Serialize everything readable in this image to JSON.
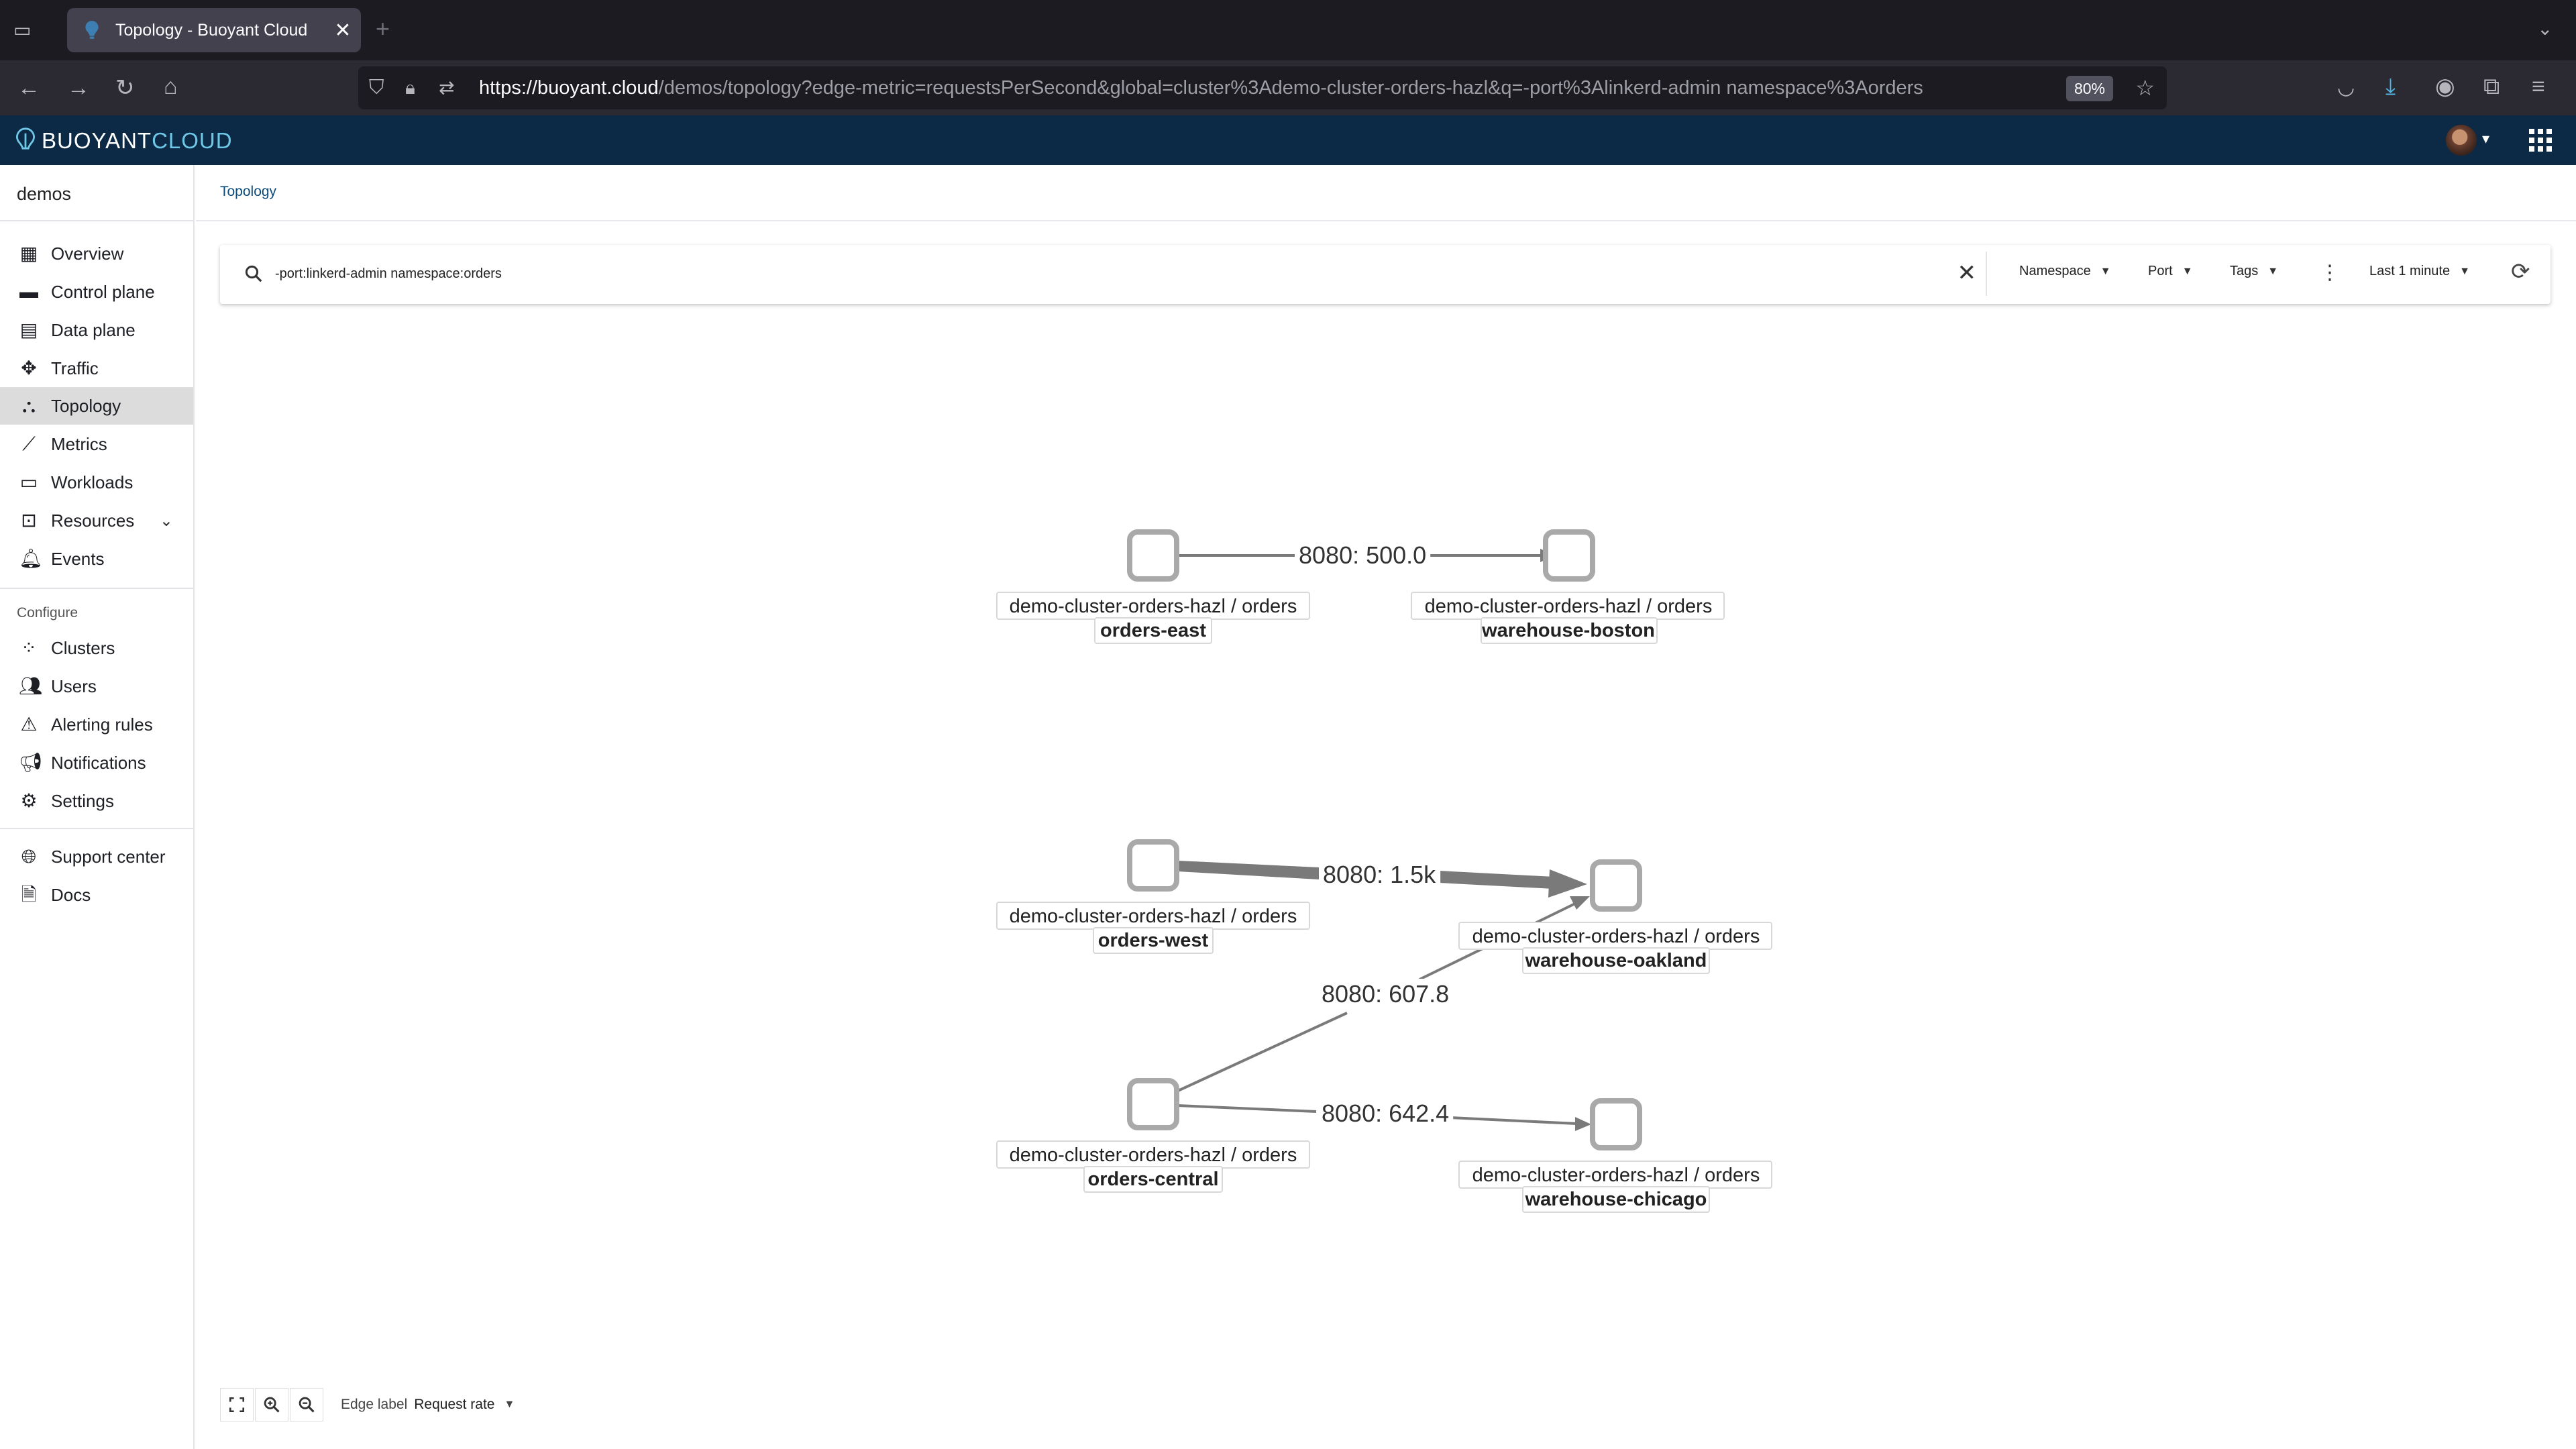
{
  "browser": {
    "tab_title": "Topology - Buoyant Cloud",
    "url_host": "https://buoyant.cloud",
    "url_path": "/demos/topology?edge-metric=requestsPerSecond&global=cluster%3Ademo-cluster-orders-hazl&q=-port%3Alinkerd-admin namespace%3Aorders",
    "zoom": "80%"
  },
  "app": {
    "logo_main": "BUOYANT",
    "logo_accent": "CLOUD"
  },
  "sidebar": {
    "org": "demos",
    "items": [
      {
        "label": "Overview",
        "icon": "dashboard-icon"
      },
      {
        "label": "Control plane",
        "icon": "control-plane-icon"
      },
      {
        "label": "Data plane",
        "icon": "data-plane-icon"
      },
      {
        "label": "Traffic",
        "icon": "traffic-icon"
      },
      {
        "label": "Topology",
        "icon": "topology-icon",
        "active": true
      },
      {
        "label": "Metrics",
        "icon": "metrics-icon"
      },
      {
        "label": "Workloads",
        "icon": "workloads-icon"
      },
      {
        "label": "Resources",
        "icon": "resources-icon"
      },
      {
        "label": "Events",
        "icon": "bell-icon"
      }
    ],
    "configure_label": "Configure",
    "config_items": [
      {
        "label": "Clusters",
        "icon": "clusters-icon"
      },
      {
        "label": "Users",
        "icon": "users-icon"
      },
      {
        "label": "Alerting rules",
        "icon": "warning-icon"
      },
      {
        "label": "Notifications",
        "icon": "megaphone-icon"
      },
      {
        "label": "Settings",
        "icon": "gear-icon"
      }
    ],
    "support_items": [
      {
        "label": "Support center",
        "icon": "globe-icon"
      },
      {
        "label": "Docs",
        "icon": "doc-icon"
      }
    ]
  },
  "main": {
    "breadcrumb": "Topology",
    "search_value": "-port:linkerd-admin namespace:orders",
    "filters": {
      "namespace": "Namespace",
      "port": "Port",
      "tags": "Tags",
      "time": "Last 1 minute"
    },
    "edge_label_title": "Edge label",
    "edge_label_value": "Request rate"
  },
  "graph": {
    "nodes": [
      {
        "id": "orders-east",
        "path": "demo-cluster-orders-hazl / orders",
        "name": "orders-east"
      },
      {
        "id": "warehouse-boston",
        "path": "demo-cluster-orders-hazl / orders",
        "name": "warehouse-boston"
      },
      {
        "id": "orders-west",
        "path": "demo-cluster-orders-hazl / orders",
        "name": "orders-west"
      },
      {
        "id": "warehouse-oakland",
        "path": "demo-cluster-orders-hazl / orders",
        "name": "warehouse-oakland"
      },
      {
        "id": "orders-central",
        "path": "demo-cluster-orders-hazl / orders",
        "name": "orders-central"
      },
      {
        "id": "warehouse-chicago",
        "path": "demo-cluster-orders-hazl / orders",
        "name": "warehouse-chicago"
      }
    ],
    "edges": [
      {
        "from": "orders-east",
        "to": "warehouse-boston",
        "port": "8080",
        "rate": "500.0",
        "label": "8080: 500.0"
      },
      {
        "from": "orders-west",
        "to": "warehouse-oakland",
        "port": "8080",
        "rate": "1.5k",
        "label": "8080: 1.5k"
      },
      {
        "from": "orders-central",
        "to": "warehouse-oakland",
        "port": "8080",
        "rate": "607.8",
        "label": "8080: 607.8"
      },
      {
        "from": "orders-central",
        "to": "warehouse-chicago",
        "port": "8080",
        "rate": "642.4",
        "label": "8080: 642.4"
      }
    ]
  }
}
